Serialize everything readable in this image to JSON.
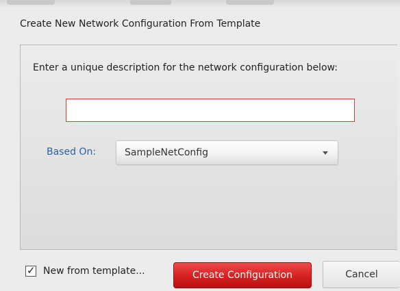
{
  "dialog": {
    "title": "Create New Network Configuration From Template",
    "instruction": "Enter a unique description for the network configuration below:",
    "description_input": {
      "value": "",
      "placeholder": ""
    },
    "based_on": {
      "label": "Based On:",
      "selected": "SampleNetConfig"
    },
    "new_from_template": {
      "label": "New from template...",
      "checked": true
    },
    "create_button_label": "Create Configuration",
    "cancel_button_label": "Cancel",
    "colors": {
      "accent_red": "#d62020",
      "label_blue": "#2b5fa8",
      "input_error_border": "#d23c3c"
    }
  }
}
